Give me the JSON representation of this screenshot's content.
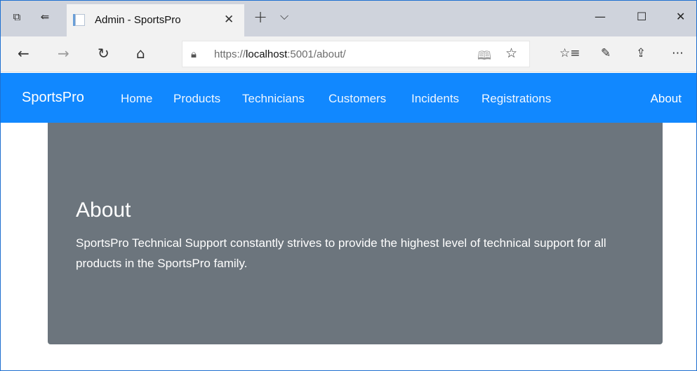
{
  "browser": {
    "tab_title": "Admin - SportsPro",
    "url_prefix": "https://",
    "url_host": "localhost",
    "url_suffix": ":5001/about/"
  },
  "site": {
    "brand": "SportsPro",
    "nav": [
      "Home",
      "Products",
      "Technicians",
      "Customers",
      "Incidents",
      "Registrations"
    ],
    "about_link": "About"
  },
  "jumbotron": {
    "title": "About",
    "text": "SportsPro Technical Support constantly strives to provide the highest level of technical support for all products in the SportsPro family."
  },
  "colors": {
    "nav_bg": "#1188ff",
    "jumbotron_bg": "#6c757d"
  }
}
